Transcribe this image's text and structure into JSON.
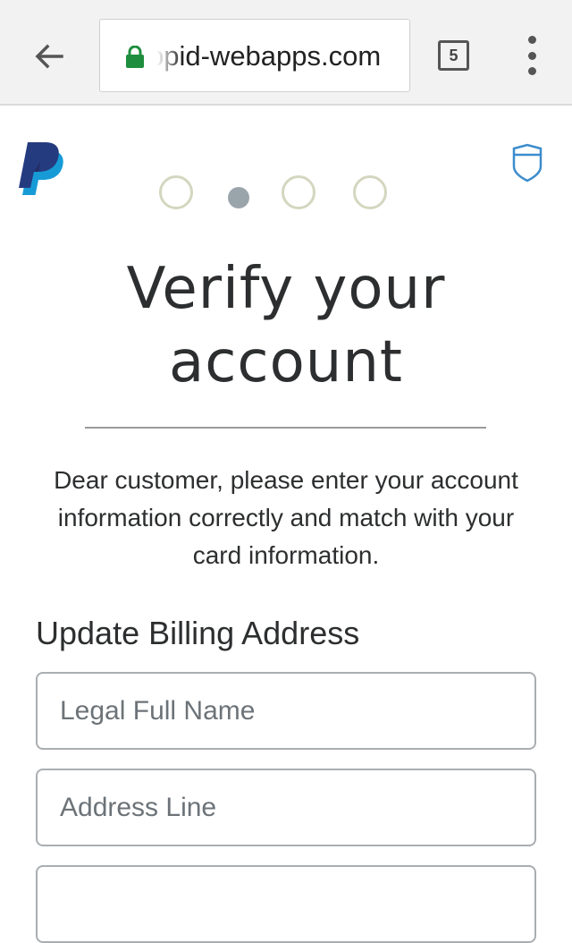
{
  "browser": {
    "url": "ppid-webapps.com",
    "tab_count": "5",
    "colors": {
      "lock": "#1e8e3e",
      "toolbar_bg": "#f2f2f2"
    }
  },
  "page": {
    "brand_icon": "paypal-logo",
    "security_icon": "shield-icon",
    "progress": {
      "total_steps": 4,
      "current_step": 2
    },
    "title_line1": "Verify your",
    "title_line2": "account",
    "description": "Dear customer, please enter your account information correctly and match with your card information.",
    "section_title": "Update Billing Address",
    "fields": [
      {
        "placeholder": "Legal Full Name",
        "value": ""
      },
      {
        "placeholder": "Address Line",
        "value": ""
      },
      {
        "placeholder": "",
        "value": ""
      }
    ],
    "colors": {
      "paypal_dark": "#253b80",
      "paypal_light": "#179bd7",
      "shield": "#3c8ccc",
      "step_ring": "#d4d6bf",
      "step_active": "#9aa5ab",
      "text": "#2c2e2f"
    }
  }
}
